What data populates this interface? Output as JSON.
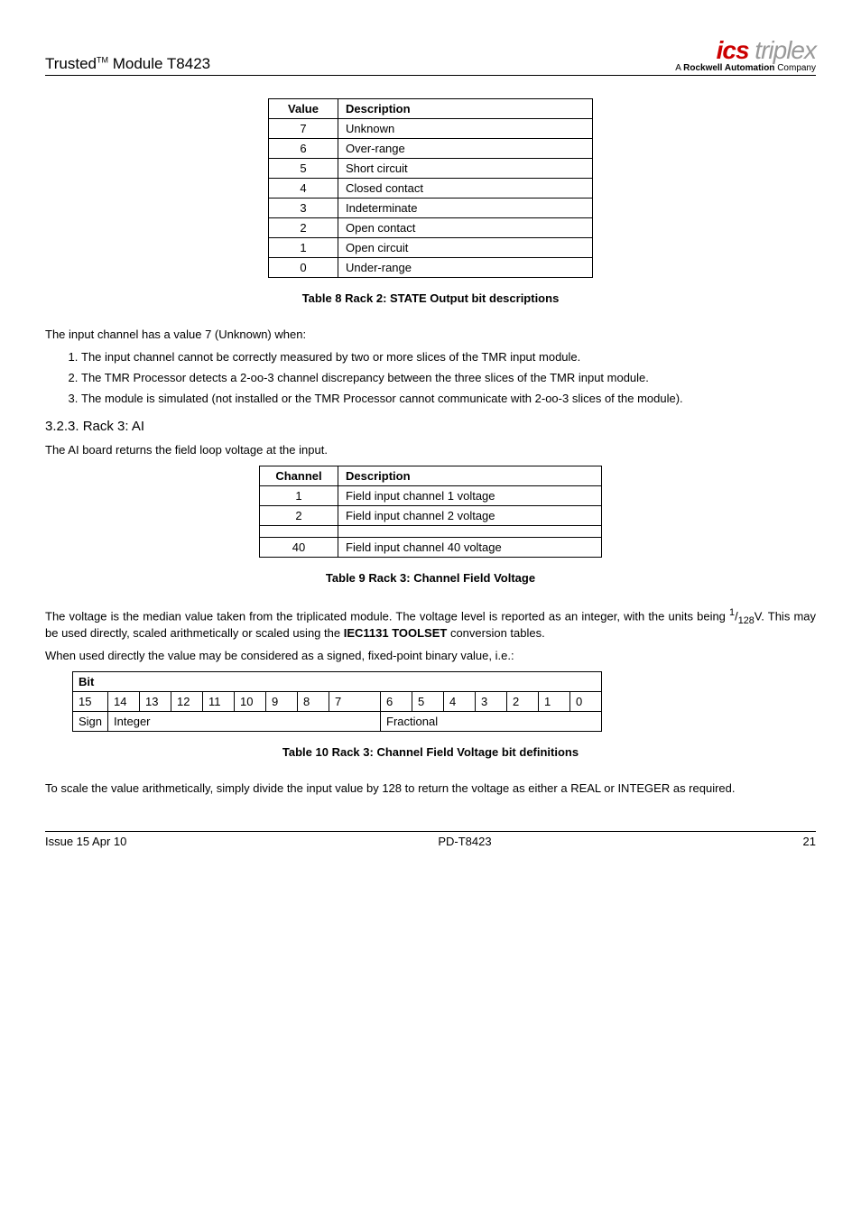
{
  "header": {
    "product": "Trusted",
    "tm": "TM",
    "module": " Module T8423",
    "logo_ics": "ics",
    "logo_trip": " triplex",
    "tagline_pre": "A ",
    "tagline_bold": "Rockwell Automation",
    "tagline_post": " Company"
  },
  "table8": {
    "h1": "Value",
    "h2": "Description",
    "rows": [
      {
        "v": "7",
        "d": "Unknown"
      },
      {
        "v": "6",
        "d": "Over-range"
      },
      {
        "v": "5",
        "d": "Short circuit"
      },
      {
        "v": "4",
        "d": "Closed contact"
      },
      {
        "v": "3",
        "d": "Indeterminate"
      },
      {
        "v": "2",
        "d": "Open contact"
      },
      {
        "v": "1",
        "d": "Open circuit"
      },
      {
        "v": "0",
        "d": "Under-range"
      }
    ],
    "caption": "Table 8 Rack 2: STATE Output bit descriptions"
  },
  "para1": "The input channel has a value 7 (Unknown) when:",
  "list1": [
    "The input channel cannot be correctly measured by two or more slices of the TMR input module.",
    "The TMR Processor detects a 2-oo-3 channel discrepancy between the three slices of the TMR input module.",
    "The module is simulated (not installed or the TMR Processor cannot communicate with 2-oo-3 slices of the module)."
  ],
  "section": "3.2.3.  Rack 3: AI",
  "para2": "The AI board returns the field loop voltage at the input.",
  "table9": {
    "h1": "Channel",
    "h2": "Description",
    "r1v": "1",
    "r1d": "Field input channel 1 voltage",
    "r2v": "2",
    "r2d": "Field input channel 2 voltage",
    "r3v": "40",
    "r3d": "Field input channel 40 voltage",
    "caption": "Table 9 Rack 3: Channel Field Voltage"
  },
  "para3_a": "The voltage is the median value taken from the triplicated module.  The voltage level is reported as an integer, with the units being ",
  "para3_sup": "1",
  "para3_sub": "128",
  "para3_b": "V.  This may be used directly, scaled arithmetically or scaled using the ",
  "para3_bold": "IEC1131 TOOLSET",
  "para3_c": " conversion tables.",
  "para4": "When used directly the value may be considered as a signed, fixed-point binary value, i.e.:",
  "chart_data": {
    "type": "table",
    "title": "Bit",
    "header": [
      "15",
      "14",
      "13",
      "12",
      "11",
      "10",
      "9",
      "8",
      "7",
      "",
      "6",
      "5",
      "4",
      "3",
      "2",
      "1",
      "0"
    ],
    "row_label": "Sign",
    "group_a": "Integer",
    "group_b": "Fractional",
    "caption": "Table 10 Rack 3: Channel Field Voltage bit definitions"
  },
  "para5": "To scale the value arithmetically, simply divide the input value by 128 to return the voltage as either a REAL or INTEGER as required.",
  "footer": {
    "left": "Issue 15 Apr 10",
    "mid": "PD-T8423",
    "right": "21"
  }
}
